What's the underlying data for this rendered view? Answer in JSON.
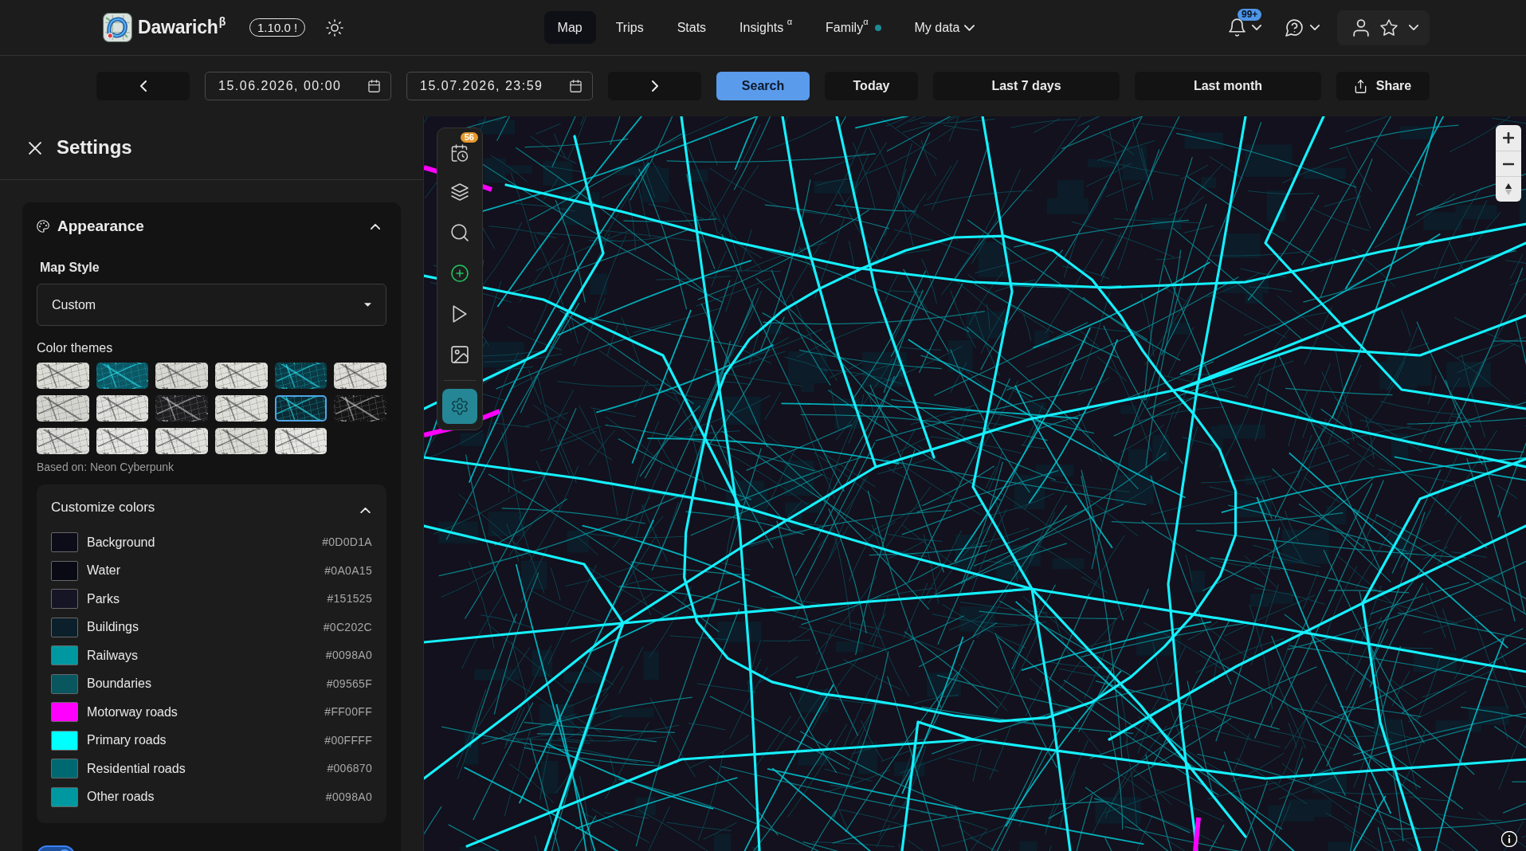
{
  "navbar": {
    "logo": "Dawarich$^{β}$",
    "version": "1.10.0 !",
    "links": [
      {
        "label": "Map",
        "selected": true,
        "dot": false,
        "dropdown": false
      },
      {
        "label": "Trips",
        "selected": false,
        "dot": false,
        "dropdown": false
      },
      {
        "label": "Stats",
        "selected": false,
        "dot": false,
        "dropdown": false
      },
      {
        "label": "Insights $^{α}$",
        "selected": false,
        "dot": false,
        "dropdown": false
      },
      {
        "label": "Family$^{α}$",
        "selected": false,
        "dot": true,
        "dropdown": false
      },
      {
        "label": "My data",
        "selected": false,
        "dot": false,
        "dropdown": true
      }
    ],
    "notification_badge": "99+"
  },
  "date_bar": {
    "start": "15.06.2026, 00:00",
    "end": "15.07.2026, 23:59",
    "buttons": [
      {
        "label": "Search",
        "kind": "primary"
      },
      {
        "label": "Today",
        "kind": "preset"
      },
      {
        "label": "Last 7 days",
        "kind": "preset"
      },
      {
        "label": "Last month",
        "kind": "preset"
      },
      {
        "label": "Share",
        "kind": "share"
      }
    ]
  },
  "settings": {
    "title": "Settings",
    "appearance": {
      "title": "Appearance",
      "expanded": true,
      "map_style_label": "Map Style",
      "map_style": "Custom",
      "color_themes_label": "Color themes",
      "themes": [
        {
          "color": "#dcdcd6",
          "selected": false
        },
        {
          "color": "#0b5864",
          "selected": false
        },
        {
          "color": "#d8d8d3",
          "selected": false
        },
        {
          "color": "#e1e1dc",
          "selected": false
        },
        {
          "color": "#093c46",
          "selected": false
        },
        {
          "color": "#deddd8",
          "selected": false
        },
        {
          "color": "#d4d4cf",
          "selected": false
        },
        {
          "color": "#dfdfdb",
          "selected": false
        },
        {
          "color": "#1e1e20",
          "selected": false
        },
        {
          "color": "#dfdfda",
          "selected": false
        },
        {
          "color": "#0b2a33",
          "selected": true
        },
        {
          "color": "#151515",
          "selected": false
        },
        {
          "color": "#dcdcd8",
          "selected": false
        },
        {
          "color": "#e4e4e1",
          "selected": false
        },
        {
          "color": "#e1e1dd",
          "selected": false
        },
        {
          "color": "#dbdbd6",
          "selected": false
        },
        {
          "color": "#e5e5e2",
          "selected": false
        }
      ],
      "based_on": "Based on: Neon Cyberpunk",
      "customize_colors": {
        "title": "Customize colors",
        "expanded": true,
        "colors": [
          {
            "name": "Background",
            "value": "#0D0D1A",
            "color": "#0d0d1a"
          },
          {
            "name": "Water",
            "value": "#0A0A15",
            "color": "#0a0a15"
          },
          {
            "name": "Parks",
            "value": "#151525",
            "color": "#151525"
          },
          {
            "name": "Buildings",
            "value": "#0C202C",
            "color": "#0c202c"
          },
          {
            "name": "Railways",
            "value": "#0098A0",
            "color": "#0098a0"
          },
          {
            "name": "Boundaries",
            "value": "#09565F",
            "color": "#09565f"
          },
          {
            "name": "Motorway roads",
            "value": "#FF00FF",
            "color": "#ff00ff"
          },
          {
            "name": "Primary roads",
            "value": "#00FFFF",
            "color": "#00ffff"
          },
          {
            "name": "Residential roads",
            "value": "#006870",
            "color": "#006870"
          },
          {
            "name": "Other roads",
            "value": "#0098A0",
            "color": "#0098a0"
          }
        ]
      },
      "toggle": {
        "on": true
      }
    }
  },
  "map_tools": {
    "badge": "56",
    "items": [
      {
        "selected": false
      },
      {
        "selected": false
      },
      {
        "selected": false
      },
      {
        "selected": false
      },
      {
        "selected": false
      },
      {
        "selected": false
      },
      {
        "selected": true
      }
    ]
  }
}
